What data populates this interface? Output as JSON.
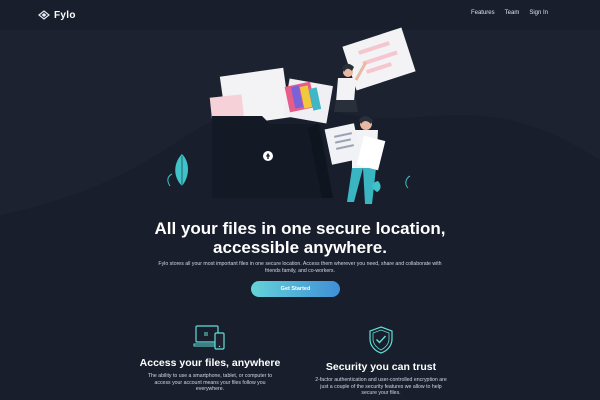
{
  "nav": {
    "logo_text": "Fylo",
    "links": [
      "Features",
      "Team",
      "Sign In"
    ]
  },
  "hero": {
    "title_line1": "All your files in one secure location,",
    "title_line2": "accessible anywhere.",
    "description_line1": "Fylo stores all your most important files in one secure location. Access them wherever you need, share and collaborate with",
    "description_line2": "friends family, and co-workers.",
    "cta_label": "Get Started"
  },
  "features": [
    {
      "icon": "devices-icon",
      "title": "Access your files, anywhere",
      "description": "The ability to use a smartphone, tablet, or computer to access your account means your files follow you everywhere."
    },
    {
      "icon": "shield-check-icon",
      "title": "Security you can trust",
      "description": "2-factor authentication and user-controlled encryption are just a couple of the security features we allow to help secure your files."
    }
  ],
  "colors": {
    "background": "#1c2230",
    "header": "#181e2b",
    "accent_teal": "#64d3d9",
    "accent_blue": "#3f8fd6",
    "icon_teal": "#62e0d9"
  }
}
